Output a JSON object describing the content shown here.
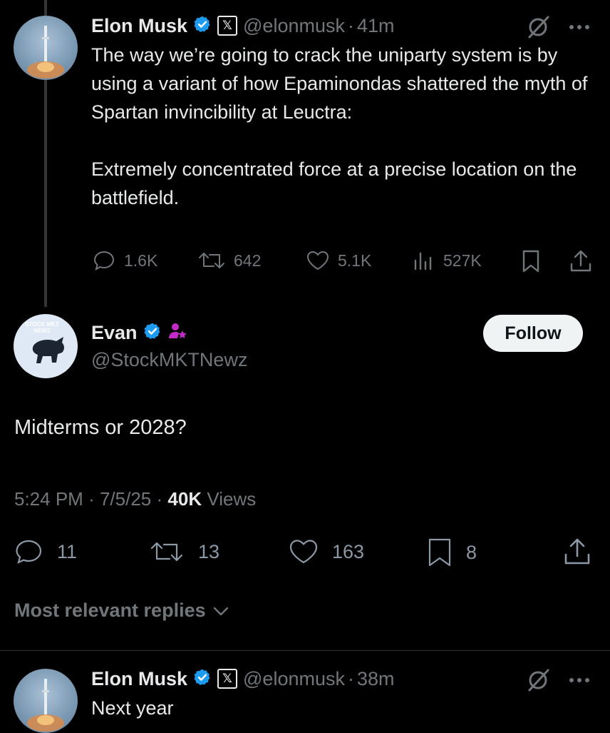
{
  "tweet1": {
    "name": "Elon Musk",
    "handle": "@elonmusk",
    "separator": "·",
    "time": "41m",
    "text": "The way we’re going to crack the uniparty system is by using a variant of how Epaminondas shattered the myth of Spartan invincibility at Leuctra:\n\nExtremely concentrated force at a precise location on the battlefield.",
    "replies": "1.6K",
    "reposts": "642",
    "likes": "5.1K",
    "views": "527K"
  },
  "main_tweet": {
    "name": "Evan",
    "handle": "@StockMKTNewz",
    "avatar_text": "STOCK MKT NEWZ",
    "follow_label": "Follow",
    "text": "Midterms or 2028?",
    "time": "5:24 PM",
    "date": "7/5/25",
    "views_count": "40K",
    "views_label": "Views",
    "replies": "11",
    "reposts": "13",
    "likes": "163",
    "bookmarks": "8"
  },
  "replies_sort": {
    "label": "Most relevant replies"
  },
  "reply1": {
    "name": "Elon Musk",
    "handle": "@elonmusk",
    "time": "38m",
    "text": "Next year"
  },
  "colors": {
    "verified_blue": "#1d9bf0",
    "affiliate_badge": "#c42ac8",
    "secondary_text": "#71767b"
  },
  "icons": [
    "verified-icon",
    "x-affiliate-icon",
    "grok-icon",
    "more-icon",
    "reply-icon",
    "repost-icon",
    "like-icon",
    "views-icon",
    "bookmark-icon",
    "share-icon",
    "chevron-down-icon"
  ]
}
